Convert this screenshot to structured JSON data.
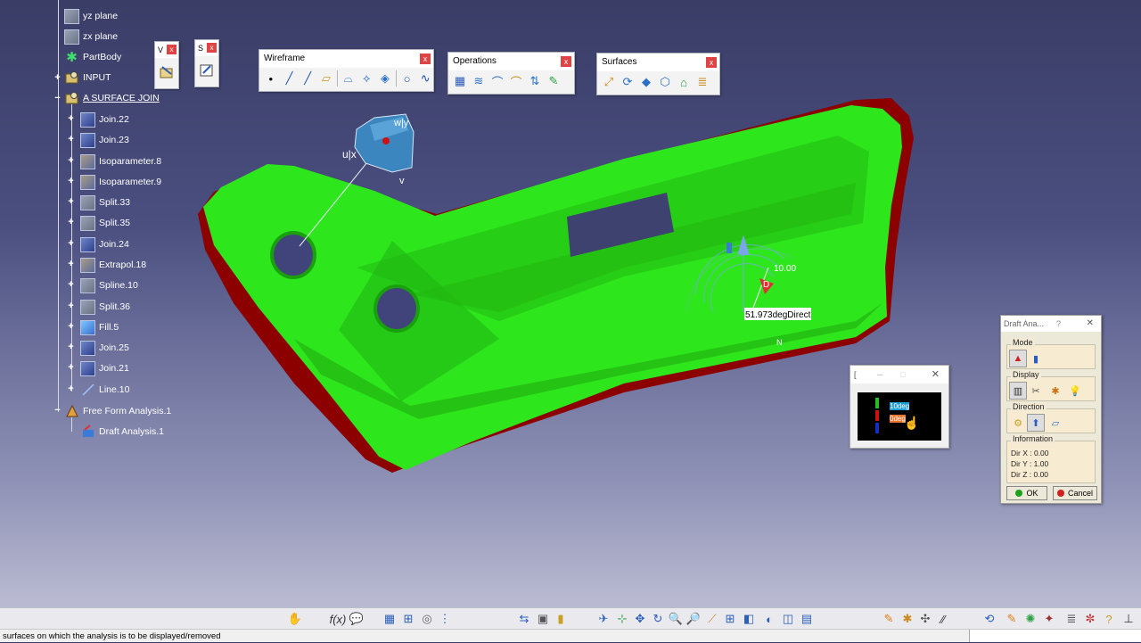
{
  "spec_tree": {
    "items": [
      {
        "label": "yz plane",
        "icon": "plane-icon"
      },
      {
        "label": "zx plane",
        "icon": "plane-icon"
      },
      {
        "label": "PartBody",
        "icon": "gear-icon"
      },
      {
        "label": "INPUT",
        "icon": "geometrical-set-icon"
      },
      {
        "label": "A SURFACE JOIN",
        "icon": "geometrical-set-icon"
      },
      {
        "label": "Join.22",
        "icon": "join-icon"
      },
      {
        "label": "Join.23",
        "icon": "join-icon"
      },
      {
        "label": "Isoparameter.8",
        "icon": "isoparameter-icon"
      },
      {
        "label": "Isoparameter.9",
        "icon": "isoparameter-icon"
      },
      {
        "label": "Split.33",
        "icon": "split-icon"
      },
      {
        "label": "Split.35",
        "icon": "split-icon"
      },
      {
        "label": "Join.24",
        "icon": "join-icon"
      },
      {
        "label": "Extrapol.18",
        "icon": "extrapolate-icon"
      },
      {
        "label": "Spline.10",
        "icon": "spline-icon"
      },
      {
        "label": "Split.36",
        "icon": "split-icon"
      },
      {
        "label": "Fill.5",
        "icon": "fill-icon"
      },
      {
        "label": "Join.25",
        "icon": "join-icon"
      },
      {
        "label": "Join.21",
        "icon": "join-icon"
      },
      {
        "label": "Line.10",
        "icon": "line-icon"
      },
      {
        "label": "Free Form Analysis.1",
        "icon": "analysis-set-icon"
      },
      {
        "label": "Draft Analysis.1",
        "icon": "draft-analysis-icon"
      }
    ]
  },
  "mini_toolbars": {
    "first_title": "V",
    "second_title": "S",
    "close": "x"
  },
  "toolbars": {
    "wireframe": {
      "title": "Wireframe",
      "close": "x",
      "icons": [
        "point-icon",
        "line-icon",
        "axis-icon",
        "plane-icon",
        "projection-icon",
        "intersection-icon",
        "offset-icon",
        "circle-icon",
        "spline-icon"
      ]
    },
    "operations": {
      "title": "Operations",
      "close": "x",
      "icons": [
        "join-icon",
        "healing-icon",
        "split-icon",
        "fillet-icon",
        "transform-icon",
        "extrapolate-icon"
      ]
    },
    "surfaces": {
      "title": "Surfaces",
      "close": "x",
      "icons": [
        "extrude-icon",
        "revolve-icon",
        "sweep-icon",
        "fill-icon",
        "multisection-icon",
        "blend-icon"
      ]
    }
  },
  "viewport": {
    "compass": {
      "u_label": "u|x",
      "w_label": "w|y",
      "v_label": "v"
    },
    "manipulator": {
      "value": "10.00",
      "angle_label": "51.973degDirect",
      "letter": "D",
      "normal_label": "N"
    },
    "colors": {
      "surface": "#2ee61c",
      "draft": "#8c0000",
      "background_top": "#3a3d66"
    }
  },
  "color_scale": {
    "title": "[",
    "entries": [
      {
        "label": "10deg",
        "color": "#1f9bd8"
      },
      {
        "label": "0deg",
        "color": "#e9742b"
      }
    ]
  },
  "draft_dialog": {
    "title": "Draft Ana...",
    "help": "?",
    "close": "✕",
    "mode_label": "Mode",
    "display_label": "Display",
    "direction_label": "Direction",
    "information_label": "Information",
    "dir_x": "Dir X : 0.00",
    "dir_y": "Dir Y : 1.00",
    "dir_z": "Dir Z : 0.00",
    "ok_label": "OK",
    "cancel_label": "Cancel"
  },
  "status_bar": {
    "message": "surfaces on which the analysis is to be displayed/removed"
  }
}
